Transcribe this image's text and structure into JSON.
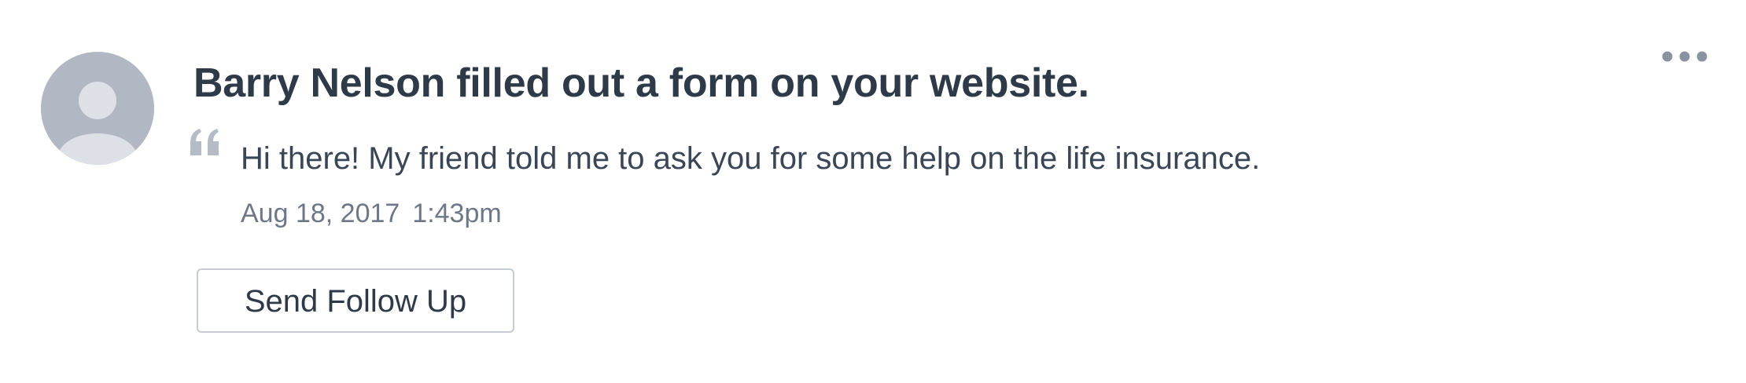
{
  "activity": {
    "contact_name": "Barry Nelson",
    "action_text": "filled out a form on your website.",
    "message": "Hi there! My friend told me to ask you for some help on the life insurance.",
    "date": "Aug 18, 2017",
    "time": "1:43pm"
  },
  "actions": {
    "follow_up_label": "Send Follow Up",
    "more_icon": "more-horizontal-icon"
  },
  "icons": {
    "avatar": "default-user-avatar",
    "quote": "quote-icon"
  },
  "colors": {
    "avatar_bg": "#b1b7c3",
    "avatar_figure": "#dde1e7",
    "text_primary": "#2f3a48",
    "text_muted": "#6d7786",
    "button_border": "#c7ccd4",
    "quote_mark": "#b6bcc6"
  }
}
